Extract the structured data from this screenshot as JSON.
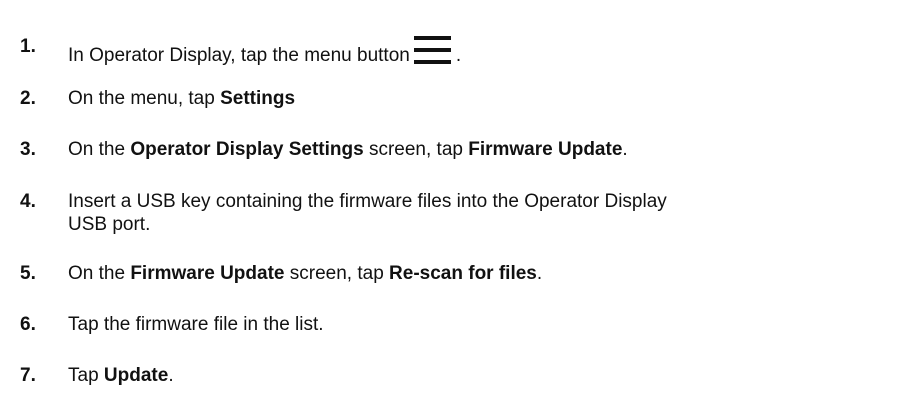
{
  "steps": [
    {
      "number": "1.",
      "text_before": "In Operator Display, tap the menu button",
      "icon": "hamburger-menu-icon",
      "text_after": "."
    },
    {
      "number": "2.",
      "text_before": "On the menu, tap ",
      "bold": "Settings"
    },
    {
      "number": "3.",
      "text_before": "On the ",
      "bold1": "Operator Display Settings",
      "text_middle": " screen, tap ",
      "bold2": "Firmware Update",
      "text_after": "."
    },
    {
      "number": "4.",
      "text_line1": "Insert a USB key containing the firmware files into the Operator Display",
      "text_line2": "USB port."
    },
    {
      "number": "5.",
      "text_before": "On the ",
      "bold1": "Firmware Update",
      "text_middle": " screen, tap ",
      "bold2": "Re-scan for files",
      "text_after": "."
    },
    {
      "number": "6.",
      "text": "Tap the firmware file in the list."
    },
    {
      "number": "7.",
      "text_before": "Tap ",
      "bold": "Update",
      "text_after": "."
    }
  ]
}
